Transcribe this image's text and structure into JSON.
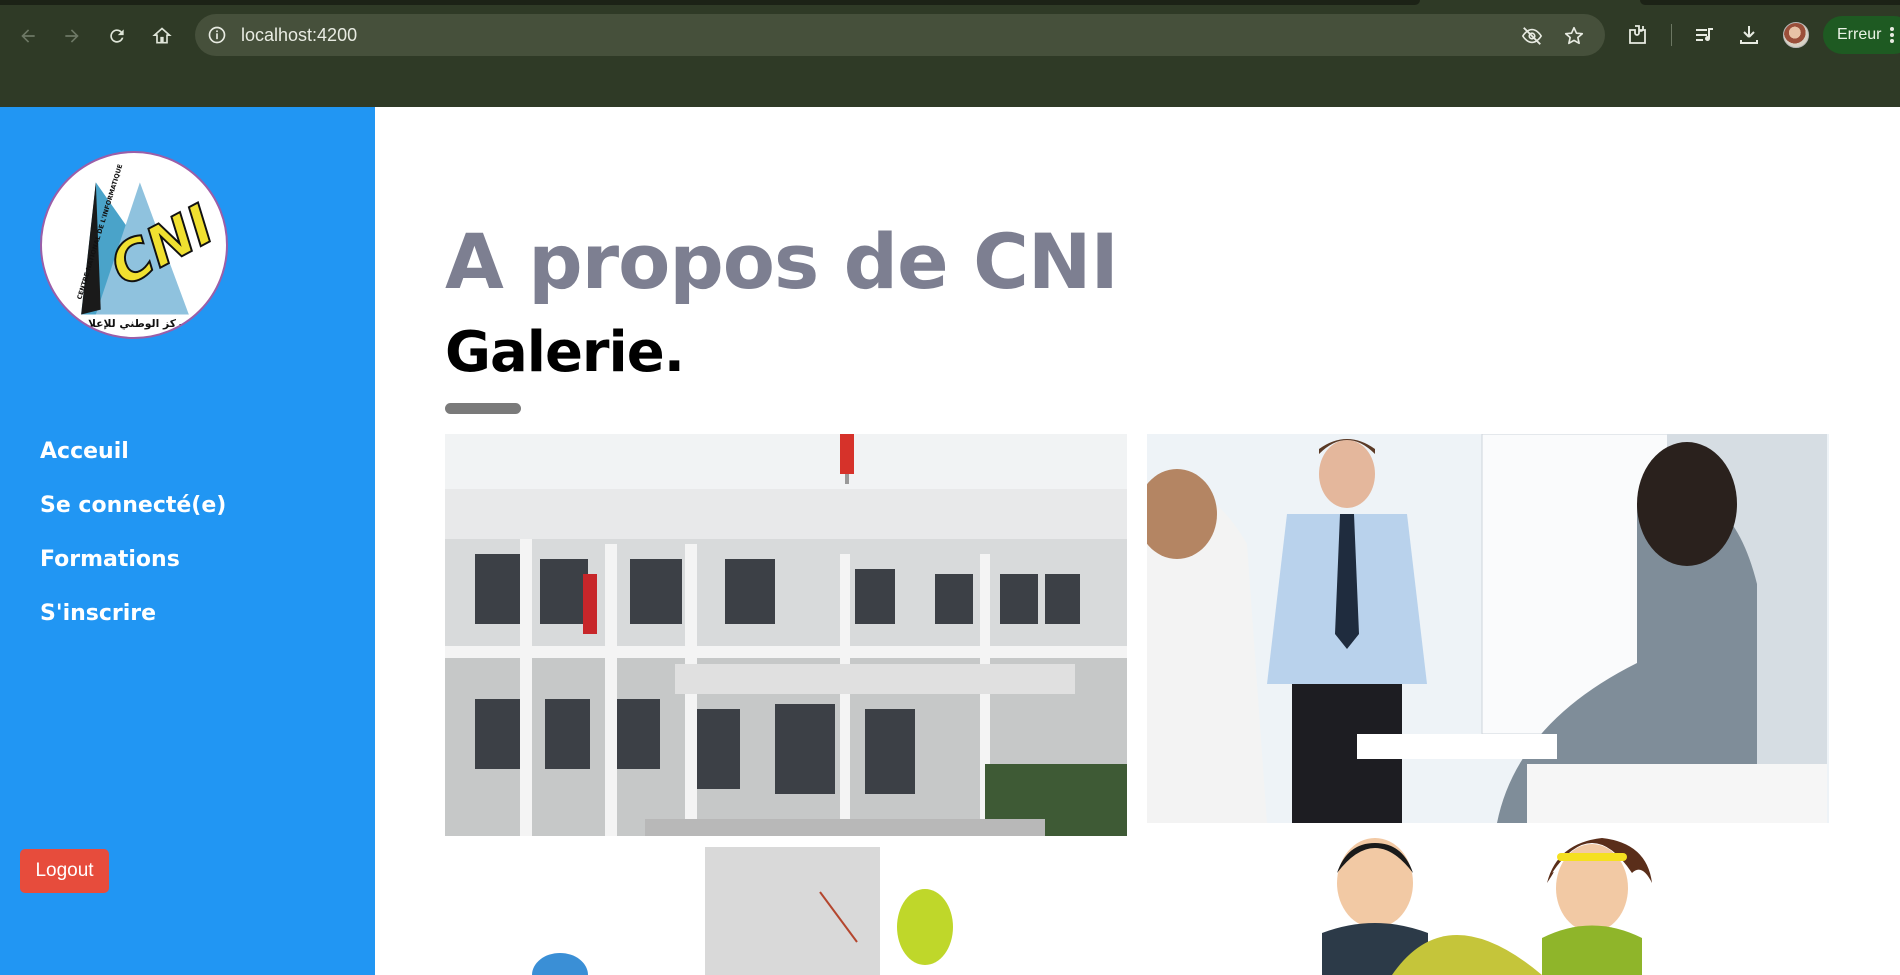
{
  "browser": {
    "url": "localhost:4200",
    "profile_status": "Erreur",
    "icons": [
      "back-icon",
      "forward-icon",
      "reload-icon",
      "home-icon",
      "site-info-icon",
      "eye-off-icon",
      "star-icon",
      "extensions-icon",
      "media-icon",
      "download-icon",
      "avatar",
      "more-vert-icon"
    ]
  },
  "sidebar": {
    "logo": {
      "text": "CNI",
      "arabic": "المركز الوطني للإعلامية",
      "circular": "CENTRE NATIONAL DE L'INFORMATIQUE"
    },
    "nav": [
      {
        "label": "Acceuil"
      },
      {
        "label": "Se connecté(e)"
      },
      {
        "label": "Formations"
      },
      {
        "label": "S'inscrire"
      }
    ],
    "logout_label": "Logout"
  },
  "main": {
    "title": "A propos de CNI",
    "section": "Galerie.",
    "gallery": [
      "building-photo",
      "meeting-photo",
      "balloons-photo",
      "people-illustration"
    ]
  },
  "colors": {
    "sidebar": "#2196f3",
    "logout": "#e74c3c",
    "title": "#7d7f91",
    "browser_frame": "#2f3a26"
  }
}
